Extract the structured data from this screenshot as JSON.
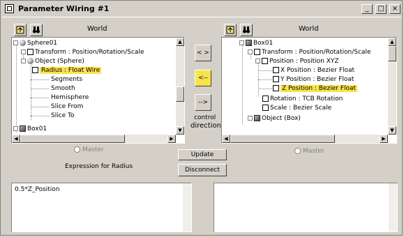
{
  "window": {
    "title": "Parameter Wiring #1",
    "controls": {
      "minimize": "_",
      "maximize": "□",
      "close": "×"
    }
  },
  "left_panel": {
    "header": "World",
    "tree": [
      {
        "label": "Sphere01"
      },
      {
        "label": "Transform : Position/Rotation/Scale"
      },
      {
        "label": "Object (Sphere)"
      },
      {
        "label": "Radius : Float Wire",
        "selected": true
      },
      {
        "label": "Segments"
      },
      {
        "label": "Smooth"
      },
      {
        "label": "Hemisphere"
      },
      {
        "label": "Slice From"
      },
      {
        "label": "Slice To"
      },
      {
        "label": "Box01"
      }
    ],
    "master_label": "Master",
    "expression_label": "Expression for Radius",
    "expression_value": "0.5*Z_Position"
  },
  "right_panel": {
    "header": "World",
    "tree": [
      {
        "label": "Box01"
      },
      {
        "label": "Transform : Position/Rotation/Scale"
      },
      {
        "label": "Position : Position XYZ"
      },
      {
        "label": "X Position : Bezier Float"
      },
      {
        "label": "Y Position : Bezier Float"
      },
      {
        "label": "Z Position : Bezier Float",
        "selected": true
      },
      {
        "label": "Rotation : TCB Rotation"
      },
      {
        "label": "Scale : Bezier Scale"
      },
      {
        "label": "Object (Box)"
      }
    ],
    "master_label": "Master",
    "expression_value": ""
  },
  "direction": {
    "right_arrow": "-->",
    "left_arrow": "<--",
    "bidirectional": "< >",
    "control_label": "control",
    "direction_label": "direction",
    "selected": "left"
  },
  "buttons": {
    "update": "Update",
    "disconnect": "Disconnect"
  },
  "colors": {
    "highlight": "#f7e44a",
    "chrome": "#d4d0c8"
  },
  "icons": {
    "toolbar_left": [
      "up-level-icon",
      "binoculars-icon"
    ],
    "toolbar_right": [
      "up-level-icon",
      "binoculars-icon"
    ]
  }
}
